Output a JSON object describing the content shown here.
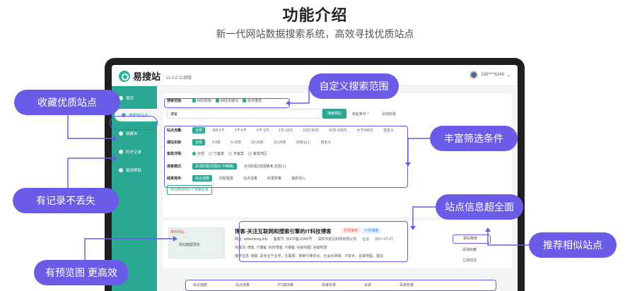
{
  "header": {
    "title": "功能介绍",
    "subtitle": "新一代网站数据搜索系统，高效寻找优质站点"
  },
  "app": {
    "logo": "易搜站",
    "version": "v1.0.0 公测版",
    "user": "155****6249"
  },
  "sidebar": {
    "items": [
      {
        "label": "首页"
      },
      {
        "label": "搜索网站点"
      },
      {
        "label": "收藏夹"
      },
      {
        "label": "历史记录"
      },
      {
        "label": "使用帮助"
      }
    ]
  },
  "search": {
    "scope_label": "搜索范围:",
    "scope_options": [
      "网站标题",
      "网站关键词",
      "站点描述"
    ],
    "query": "博客",
    "search_button": "搜索网站",
    "collapse_button": "收起条件 ^",
    "add_button": "添加收录"
  },
  "filters": {
    "rows": [
      {
        "label": "站点流量:",
        "options": [
          "全部",
          "300-1千",
          "1千-5千",
          "5千-1万",
          "1万-10万",
          "10万-50万",
          "50万-100万",
          "大于100万",
          "自定义"
        ]
      },
      {
        "label": "建站年龄:",
        "options": [
          "全部",
          "0-5年",
          "5-10年",
          "10-15年",
          "15-20年",
          "20年以上",
          "自定义"
        ]
      },
      {
        "label": "备案详情:",
        "options": [
          "全部",
          "已备案",
          "未备案",
          "备案地区"
        ]
      },
      {
        "label": "搜索模式:",
        "options": [
          "单词匹配(范围大,不精确)",
          "全词匹配(范围精准,范围小)"
        ]
      },
      {
        "label": "结果排序:",
        "options": [
          "综合指数",
          "匹配程度",
          "站点流量",
          "收录数量",
          "最新加入"
        ]
      }
    ],
    "results_count": "共找到9999+个搜索结果"
  },
  "result": {
    "badge": "推荐网站",
    "title": "博客-关注互联网和搜索引擎的IT科技博客",
    "tag1": "优质推荐",
    "tag2": "IT类博客",
    "meta_site": "网址: williamlong.info",
    "meta_icp": "备案号: 京ICP备11000号",
    "meta_company": "深圳市前沿科技有限公司",
    "meta_type": "企业",
    "meta_date": "2017-07-27",
    "keywords": "关键词: 博客, IT博客, 科技博客, IT播客, 谷歌地图, 谷歌地球",
    "description": "描述信息: 博客, 是专注于业界、互联网、搜索引擎优化、社会化网络、IT技术、谷歌地图、建站",
    "preview": "网站截图预览"
  },
  "actions": {
    "similar": "相似推荐",
    "favorite": "添加收藏",
    "visit": "立即前往"
  },
  "footer_metrics": [
    "综合指数",
    "站点流量",
    "PC端流量",
    "百度收录",
    "谷歌",
    "百度权重"
  ],
  "callouts": {
    "favorites": "收藏优质站点",
    "history": "有记录不丢失",
    "preview": "有预览图 更高效",
    "custom_scope": "自定义搜索范围",
    "rich_filters": "丰富筛选条件",
    "site_info": "站点信息超全面",
    "similar": "推荐相似站点"
  },
  "colors": {
    "accent": "#2aa893",
    "callout": "#6b5ce7",
    "frame": "#1f1f1f"
  }
}
